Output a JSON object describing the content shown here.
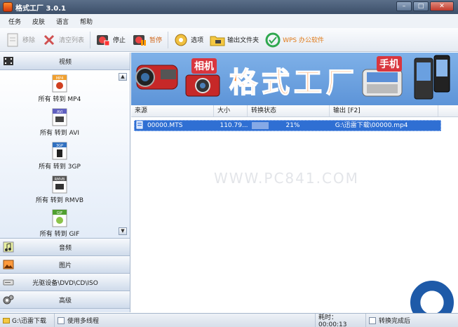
{
  "window": {
    "title": "格式工厂 3.0.1"
  },
  "menu": [
    "任务",
    "皮肤",
    "语言",
    "帮助"
  ],
  "toolbar": {
    "remove": "移除",
    "clear": "清空列表",
    "stop": "停止",
    "pause": "暂停",
    "options": "选项",
    "output_folder": "输出文件夹",
    "wps": "WPS 办公软件"
  },
  "categories": {
    "video": "视频",
    "audio": "音频",
    "image": "图片",
    "disc": "光驱设备\\DVD\\CD\\ISO",
    "advanced": "高级"
  },
  "video_formats": [
    {
      "label": "所有 转到 MP4",
      "badge": "MP4"
    },
    {
      "label": "所有 转到 AVI",
      "badge": "AVI"
    },
    {
      "label": "所有 转到 3GP",
      "badge": "3GP"
    },
    {
      "label": "所有 转到 RMVB",
      "badge": "RMVB"
    },
    {
      "label": "所有 转到 GIF",
      "badge": "GIF"
    }
  ],
  "banner": {
    "title": "格式工厂",
    "camera_tag": "相机",
    "phone_tag": "手机"
  },
  "file_list": {
    "columns": [
      "来源",
      "大小",
      "转换状态",
      "输出 [F2]"
    ],
    "rows": [
      {
        "source": "00000.MTS",
        "size": "110.79...",
        "progress": 21,
        "progress_text": "21%",
        "output": "G:\\迅雷下载\\00000.mp4"
      }
    ]
  },
  "watermark": "WWW.PC841.COM",
  "status": {
    "folder": "G:\\迅雷下载",
    "multithread": "使用多线程",
    "elapsed": "耗时：00:00:13",
    "after_done": "转换完成后"
  },
  "colors": {
    "selection": "#2f6fd3",
    "banner_text": "#ff7a1a",
    "accent": "#1e5aa8"
  }
}
